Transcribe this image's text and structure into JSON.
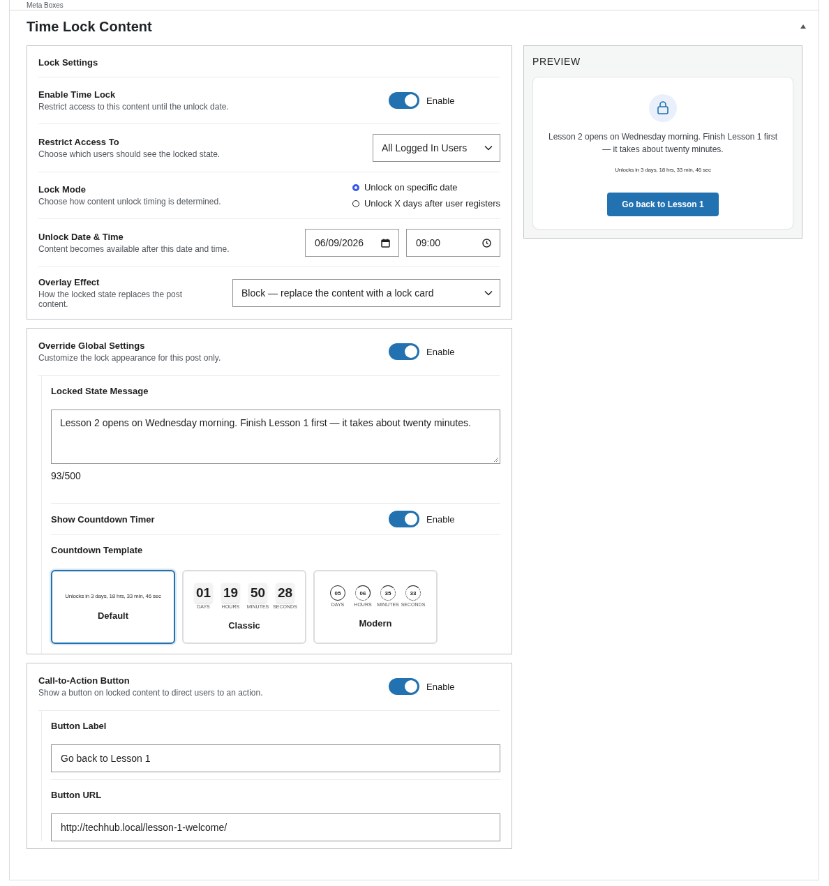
{
  "top_bar": {
    "label": "Meta Boxes"
  },
  "panel": {
    "title": "Time Lock Content",
    "expanded": true
  },
  "lock_settings": {
    "heading": "Lock Settings",
    "rows": [
      {
        "kind": "toggle",
        "label": "Enable Time Lock",
        "description": "Restrict access to this content until the unlock date.",
        "on": true,
        "toggle_label": "Enable"
      },
      {
        "kind": "select",
        "label": "Restrict Access To",
        "description": "Choose which users should see the locked state.",
        "value": "All Logged In Users"
      },
      {
        "kind": "radio",
        "label": "Lock Mode",
        "description": "Choose how content unlock timing is determined.",
        "options": [
          {
            "label": "Unlock on specific date",
            "selected": true
          },
          {
            "label": "Unlock X days after user registers",
            "selected": false
          }
        ]
      },
      {
        "kind": "datetime",
        "label": "Unlock Date & Time",
        "description": "Content becomes available after this date and time.",
        "date": "06/09/2026",
        "time": "09:00"
      },
      {
        "kind": "select",
        "label": "Overlay Effect",
        "description": "How the locked state replaces the post content.",
        "value": "Block — replace the content with a lock card"
      }
    ]
  },
  "override": {
    "label": "Override Global Settings",
    "description": "Customize the lock appearance for this post only.",
    "on": true,
    "toggle_label": "Enable",
    "message": {
      "label": "Locked State Message",
      "value": "Lesson 2 opens on Wednesday morning. Finish Lesson 1 first — it takes about twenty minutes.",
      "counter": "93/500"
    },
    "countdown": {
      "label": "Show Countdown Timer",
      "on": true,
      "toggle_label": "Enable"
    },
    "template": {
      "label": "Countdown Template",
      "options": [
        {
          "kind": "default",
          "name": "Default",
          "selected": true,
          "text": "Unlocks in 3 days, 18 hrs, 33 min, 46 sec"
        },
        {
          "kind": "classic",
          "name": "Classic",
          "selected": false,
          "units": [
            {
              "value": "01",
              "unit": "DAYS"
            },
            {
              "value": "19",
              "unit": "HOURS"
            },
            {
              "value": "50",
              "unit": "MINUTES"
            },
            {
              "value": "28",
              "unit": "SECONDS"
            }
          ]
        },
        {
          "kind": "modern",
          "name": "Modern",
          "selected": false,
          "units": [
            {
              "value": "05",
              "unit": "DAYS"
            },
            {
              "value": "06",
              "unit": "HOURS"
            },
            {
              "value": "35",
              "unit": "MINUTES"
            },
            {
              "value": "33",
              "unit": "SECONDS"
            }
          ]
        }
      ]
    }
  },
  "cta": {
    "label": "Call-to-Action Button",
    "description": "Show a button on locked content to direct users to an action.",
    "on": true,
    "toggle_label": "Enable",
    "fields": [
      {
        "label": "Button Label",
        "value": "Go back to Lesson 1"
      },
      {
        "label": "Button URL",
        "value": "http://techhub.local/lesson-1-welcome/"
      }
    ]
  },
  "preview": {
    "heading": "PREVIEW",
    "message": "Lesson 2 opens on Wednesday morning. Finish Lesson 1 first — it takes about twenty minutes.",
    "countdown": "Unlocks in 3 days, 18 hrs, 33 min, 46 sec",
    "button": "Go back to Lesson 1"
  }
}
